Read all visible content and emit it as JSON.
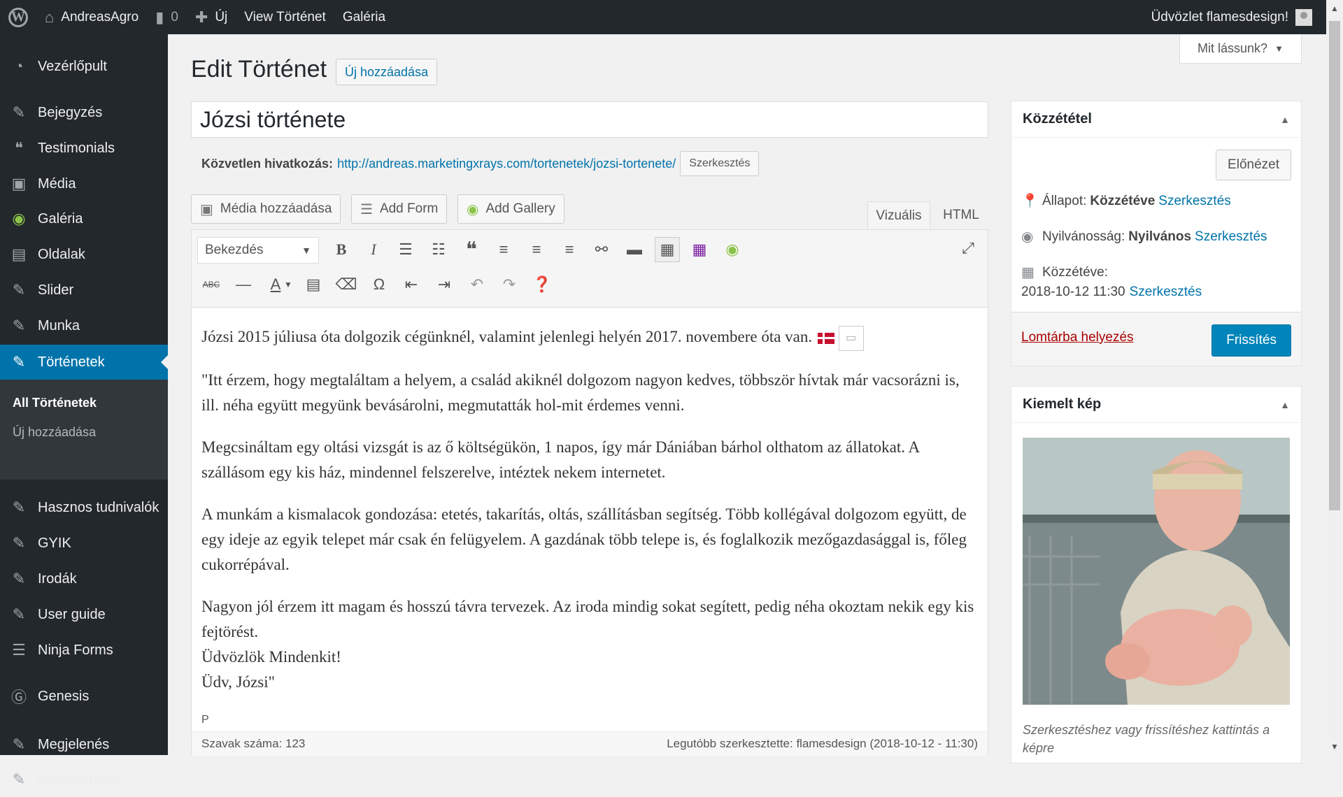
{
  "admin_bar": {
    "site_name": "AndreasAgro",
    "comments_count": "0",
    "new_label": "Új",
    "view_label": "View Történet",
    "gallery_label": "Galéria",
    "greeting": "Üdvözlet flamesdesign!"
  },
  "sidebar": {
    "items": [
      {
        "label": "Vezérlőpult",
        "icon": "dashboard-icon"
      },
      {
        "label": "Bejegyzés",
        "icon": "pin-icon"
      },
      {
        "label": "Testimonials",
        "icon": "quote-icon"
      },
      {
        "label": "Média",
        "icon": "media-icon"
      },
      {
        "label": "Galéria",
        "icon": "gallery-icon"
      },
      {
        "label": "Oldalak",
        "icon": "page-icon"
      },
      {
        "label": "Slider",
        "icon": "pin-icon"
      },
      {
        "label": "Munka",
        "icon": "pin-icon"
      },
      {
        "label": "Történetek",
        "icon": "pin-icon"
      },
      {
        "label": "Hasznos tudnivalók",
        "icon": "pin-icon"
      },
      {
        "label": "GYIK",
        "icon": "pin-icon"
      },
      {
        "label": "Irodák",
        "icon": "pin-icon"
      },
      {
        "label": "User guide",
        "icon": "pin-icon"
      },
      {
        "label": "Ninja Forms",
        "icon": "forms-icon"
      },
      {
        "label": "Genesis",
        "icon": "genesis-icon"
      },
      {
        "label": "Megjelenés",
        "icon": "appearance-icon"
      },
      {
        "label": "Bővítmények",
        "icon": "plugin-icon"
      }
    ],
    "submenu": {
      "all": "All Történetek",
      "new": "Új hozzáadása"
    }
  },
  "screen_options": "Mit lássunk?",
  "page": {
    "title": "Edit Történet",
    "add_new": "Új hozzáadása",
    "post_title": "Józsi története",
    "permalink_label": "Közvetlen hivatkozás:",
    "permalink_url": "http://andreas.marketingxrays.com/tortenetek/jozsi-tortenete/",
    "permalink_edit": "Szerkesztés"
  },
  "editor": {
    "buttons": {
      "media": "Média hozzáadása",
      "form": "Add Form",
      "gallery": "Add Gallery"
    },
    "tabs": {
      "visual": "Vizuális",
      "html": "HTML"
    },
    "format": "Bekezdés",
    "content": [
      "Józsi 2015 júliusa óta dolgozik cégünknél, valamint jelenlegi helyén 2017. novembere óta van.",
      "\"Itt érzem, hogy megtaláltam a helyem, a család akiknél dolgozom nagyon kedves, többször hívtak már vacsorázni is, ill. néha együtt megyünk bevásárolni, megmutatták hol-mit érdemes venni.",
      "Megcsináltam egy oltási vizsgát is az ő költségükön, 1 napos, így már Dániában bárhol olthatom az állatokat. A szállásom egy kis ház, mindennel felszerelve, intéztek nekem internetet.",
      "A munkám a kismalacok gondozása: etetés, takarítás, oltás, szállításban segítség. Több kollégával dolgozom együtt, de egy ideje az egyik telepet már csak én felügyelem. A gazdának több telepe is, és foglalkozik mezőgazdasággal is, főleg cukorrépával.",
      "Nagyon jól érzem itt magam és hosszú távra tervezek. Az iroda mindig sokat segített, pedig néha okoztam nekik egy kis fejtörést.",
      "Üdvözlök Mindenkit!",
      "Üdv, Józsi\""
    ],
    "path": "P",
    "word_count": "Szavak száma: 123",
    "last_edited": "Legutóbb szerkesztette: flamesdesign (2018-10-12 - 11:30)"
  },
  "publish_box": {
    "title": "Közzététel",
    "preview": "Előnézet",
    "status_label": "Állapot:",
    "status_value": "Közzétéve",
    "visibility_label": "Nyilvánosság:",
    "visibility_value": "Nyilvános",
    "published_label": "Közzétéve:",
    "published_date": "2018-10-12 11:30",
    "edit": "Szerkesztés",
    "trash": "Lomtárba helyezés",
    "update": "Frissítés"
  },
  "featured_box": {
    "title": "Kiemelt kép",
    "caption": "Szerkesztéshez vagy frissítéshez kattintás a képre"
  }
}
